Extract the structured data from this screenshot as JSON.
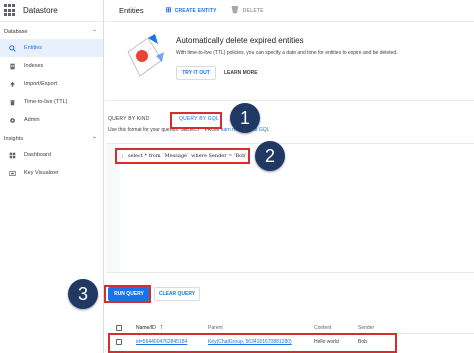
{
  "sidebar": {
    "product_title": "Datastore",
    "sections": [
      {
        "header": "Database",
        "items": [
          {
            "label": "Entities",
            "icon": "search-icon",
            "active": true
          },
          {
            "label": "Indexes",
            "icon": "document-icon"
          },
          {
            "label": "Import/Export",
            "icon": "upload-icon"
          },
          {
            "label": "Time-to-live (TTL)",
            "icon": "trash-icon"
          },
          {
            "label": "Admin",
            "icon": "gear-icon"
          }
        ]
      },
      {
        "header": "Insights",
        "items": [
          {
            "label": "Dashboard",
            "icon": "dashboard-icon"
          },
          {
            "label": "Key Visualizer",
            "icon": "key-visualizer-icon"
          }
        ]
      }
    ]
  },
  "topbar": {
    "title": "Entities",
    "create_label": "CREATE ENTITY",
    "delete_label": "DELETE"
  },
  "banner": {
    "title": "Automatically delete expired entities",
    "description": "With time-to-live (TTL) policies, you can specify a date and time for entities to expire and be deleted.",
    "try_label": "TRY IT OUT",
    "learn_label": "LEARN MORE"
  },
  "tabs": {
    "kind_label": "QUERY BY KIND",
    "gql_label": "QUERY BY GQL"
  },
  "hint": {
    "text": "Use this format for your queries: SELECT * FROM",
    "link": "earn more about GQL"
  },
  "editor": {
    "line_number": "1",
    "code": "select * from `Message` where Sender = 'Bob'"
  },
  "actions": {
    "run_label": "RUN QUERY",
    "clear_label": "CLEAR QUERY"
  },
  "table": {
    "headers": [
      "Name/ID",
      "Parent",
      "Content",
      "Sender"
    ],
    "sort_indicator": "↑",
    "rows": [
      {
        "id": "id=5644004762845184",
        "parent": "Key(ChatGroup, 5634161670881280)",
        "content": "Hello world",
        "sender": "Bob"
      }
    ]
  },
  "annotations": {
    "steps": [
      "1",
      "2",
      "3"
    ],
    "color": "#d32f2f",
    "badge_color": "#1f3864"
  },
  "colors": {
    "accent": "#1a73e8",
    "active_bg": "#e8f0fe"
  }
}
